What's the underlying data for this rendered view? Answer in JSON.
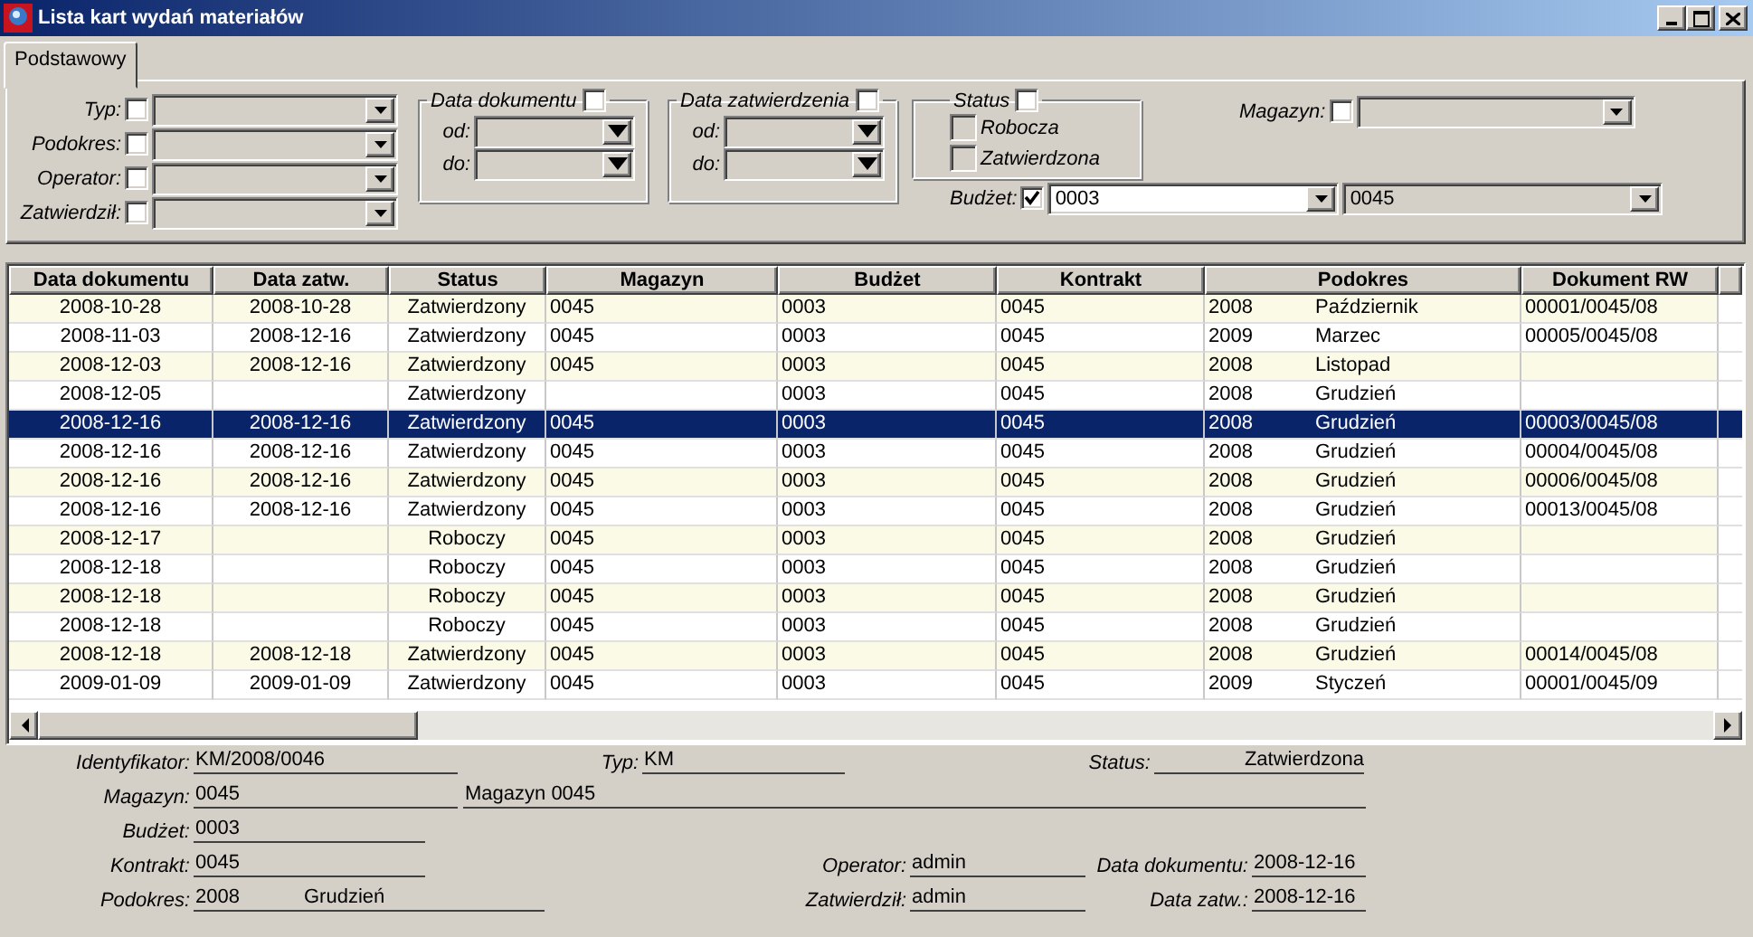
{
  "window": {
    "title": "Lista kart wydań materiałów"
  },
  "tabs": [
    {
      "label": "Podstawowy",
      "selected": true
    }
  ],
  "filters": {
    "fields": [
      {
        "label": "Typ:",
        "checked": false
      },
      {
        "label": "Podokres:",
        "checked": false
      },
      {
        "label": "Operator:",
        "checked": false
      },
      {
        "label": "Zatwierdził:",
        "checked": false
      }
    ],
    "date_groups": [
      {
        "title": "Data dokumentu",
        "checked": false,
        "from_label": "od:",
        "to_label": "do:"
      },
      {
        "title": "Data zatwierdzenia",
        "checked": false,
        "from_label": "od:",
        "to_label": "do:"
      }
    ],
    "status": {
      "title": "Status",
      "checked": false,
      "options": [
        {
          "label": "Robocza",
          "checked": false,
          "disabled": true
        },
        {
          "label": "Zatwierdzona",
          "checked": false,
          "disabled": true
        }
      ]
    },
    "magazyn": {
      "label": "Magazyn:",
      "checked": false
    },
    "budzet": {
      "label": "Budżet:",
      "checked": true,
      "value": "0003",
      "value_2": "0045"
    }
  },
  "table": {
    "columns": [
      "Data dokumentu",
      "Data zatw.",
      "Status",
      "Magazyn",
      "Budżet",
      "Kontrakt",
      "Podokres",
      "Dokument RW"
    ],
    "rows": [
      {
        "selected": false,
        "cells": [
          "2008-10-28",
          "2008-10-28",
          "Zatwierdzony",
          "0045",
          "0003",
          "0045",
          [
            "2008",
            "Październik"
          ],
          "00001/0045/08"
        ]
      },
      {
        "selected": false,
        "cells": [
          "2008-11-03",
          "2008-12-16",
          "Zatwierdzony",
          "0045",
          "0003",
          "0045",
          [
            "2009",
            "Marzec"
          ],
          "00005/0045/08"
        ]
      },
      {
        "selected": false,
        "cells": [
          "2008-12-03",
          "2008-12-16",
          "Zatwierdzony",
          "0045",
          "0003",
          "0045",
          [
            "2008",
            "Listopad"
          ],
          null
        ]
      },
      {
        "selected": false,
        "cells": [
          "2008-12-05",
          null,
          "Zatwierdzony",
          null,
          "0003",
          "0045",
          [
            "2008",
            "Grudzień"
          ],
          null
        ]
      },
      {
        "selected": true,
        "cells": [
          "2008-12-16",
          "2008-12-16",
          "Zatwierdzony",
          "0045",
          "0003",
          "0045",
          [
            "2008",
            "Grudzień"
          ],
          "00003/0045/08"
        ]
      },
      {
        "selected": false,
        "cells": [
          "2008-12-16",
          "2008-12-16",
          "Zatwierdzony",
          "0045",
          "0003",
          "0045",
          [
            "2008",
            "Grudzień"
          ],
          "00004/0045/08"
        ]
      },
      {
        "selected": false,
        "cells": [
          "2008-12-16",
          "2008-12-16",
          "Zatwierdzony",
          "0045",
          "0003",
          "0045",
          [
            "2008",
            "Grudzień"
          ],
          "00006/0045/08"
        ]
      },
      {
        "selected": false,
        "cells": [
          "2008-12-16",
          "2008-12-16",
          "Zatwierdzony",
          "0045",
          "0003",
          "0045",
          [
            "2008",
            "Grudzień"
          ],
          "00013/0045/08"
        ]
      },
      {
        "selected": false,
        "cells": [
          "2008-12-17",
          null,
          "Roboczy",
          "0045",
          "0003",
          "0045",
          [
            "2008",
            "Grudzień"
          ],
          null
        ]
      },
      {
        "selected": false,
        "cells": [
          "2008-12-18",
          null,
          "Roboczy",
          "0045",
          "0003",
          "0045",
          [
            "2008",
            "Grudzień"
          ],
          null
        ]
      },
      {
        "selected": false,
        "cells": [
          "2008-12-18",
          null,
          "Roboczy",
          "0045",
          "0003",
          "0045",
          [
            "2008",
            "Grudzień"
          ],
          null
        ]
      },
      {
        "selected": false,
        "cells": [
          "2008-12-18",
          null,
          "Roboczy",
          "0045",
          "0003",
          "0045",
          [
            "2008",
            "Grudzień"
          ],
          null
        ]
      },
      {
        "selected": false,
        "cells": [
          "2008-12-18",
          "2008-12-18",
          "Zatwierdzony",
          "0045",
          "0003",
          "0045",
          [
            "2008",
            "Grudzień"
          ],
          "00014/0045/08"
        ]
      },
      {
        "selected": false,
        "cells": [
          "2009-01-09",
          "2009-01-09",
          "Zatwierdzony",
          "0045",
          "0003",
          "0045",
          [
            "2009",
            "Styczeń"
          ],
          "00001/0045/09"
        ]
      }
    ]
  },
  "details": {
    "identyfikator": {
      "label": "Identyfikator:",
      "value": "KM/2008/0046"
    },
    "typ": {
      "label": "Typ:",
      "value": "KM"
    },
    "status": {
      "label": "Status:",
      "value": "Zatwierdzona"
    },
    "magazyn": {
      "label": "Magazyn:",
      "value": "0045",
      "name": "Magazyn 0045"
    },
    "budzet": {
      "label": "Budżet:",
      "value": "0003"
    },
    "kontrakt": {
      "label": "Kontrakt:",
      "value": "0045"
    },
    "operator": {
      "label": "Operator:",
      "value": "admin"
    },
    "data_dokumentu": {
      "label": "Data dokumentu:",
      "value": "2008-12-16"
    },
    "podokres": {
      "label": "Podokres:",
      "value": [
        "2008",
        "Grudzień"
      ]
    },
    "zatwierdzil": {
      "label": "Zatwierdził:",
      "value": "admin"
    },
    "data_zatw": {
      "label": "Data zatw.:",
      "value": "2008-12-16"
    }
  }
}
